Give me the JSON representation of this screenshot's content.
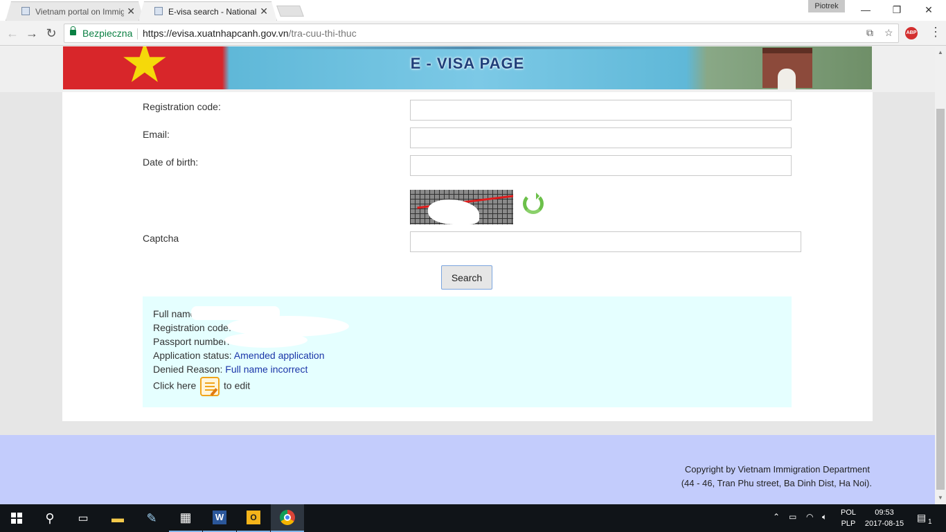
{
  "browser": {
    "profile_name": "Piotrek",
    "tabs": [
      {
        "title": "Vietnam portal on Immig",
        "active": false
      },
      {
        "title": "E-visa search - National p",
        "active": true
      }
    ],
    "security_label": "Bezpieczna",
    "url_host": "https://evisa.xuatnhapcanh.gov.vn",
    "url_path": "/tra-cuu-thi-thuc"
  },
  "banner": {
    "title": "E - VISA PAGE"
  },
  "form": {
    "registration_code_label": "Registration code:",
    "email_label": "Email:",
    "dob_label": "Date of birth:",
    "captcha_label": "Captcha",
    "search_label": "Search"
  },
  "result": {
    "full_name_label": "Full name:",
    "registration_code_label": "Registration code:",
    "passport_label": "Passport number:",
    "status_label": "Application status:",
    "status_value": "Amended application",
    "denied_label": "Denied Reason:",
    "denied_value": "Full name incorrect",
    "click_here": "Click here",
    "to_edit": "to edit"
  },
  "footer": {
    "copyright": "Copyright by Vietnam Immigration Department",
    "address": "(44 - 46, Tran Phu street, Ba Dinh Dist, Ha Noi)."
  },
  "taskbar": {
    "language_top": "POL",
    "language_bottom": "PLP",
    "time": "09:53",
    "date": "2017-08-15",
    "notification_count": "1",
    "apps": [
      "start-icon",
      "search-icon",
      "task-view-icon",
      "file-explorer-icon",
      "paint-icon",
      "calculator-icon",
      "word-icon",
      "outlook-icon",
      "chrome-icon"
    ]
  },
  "colors": {
    "link_value": "#1a35a8",
    "result_background": "#e5ffff",
    "footer_background": "#c3ccfc",
    "secure_green": "#0b8043"
  }
}
